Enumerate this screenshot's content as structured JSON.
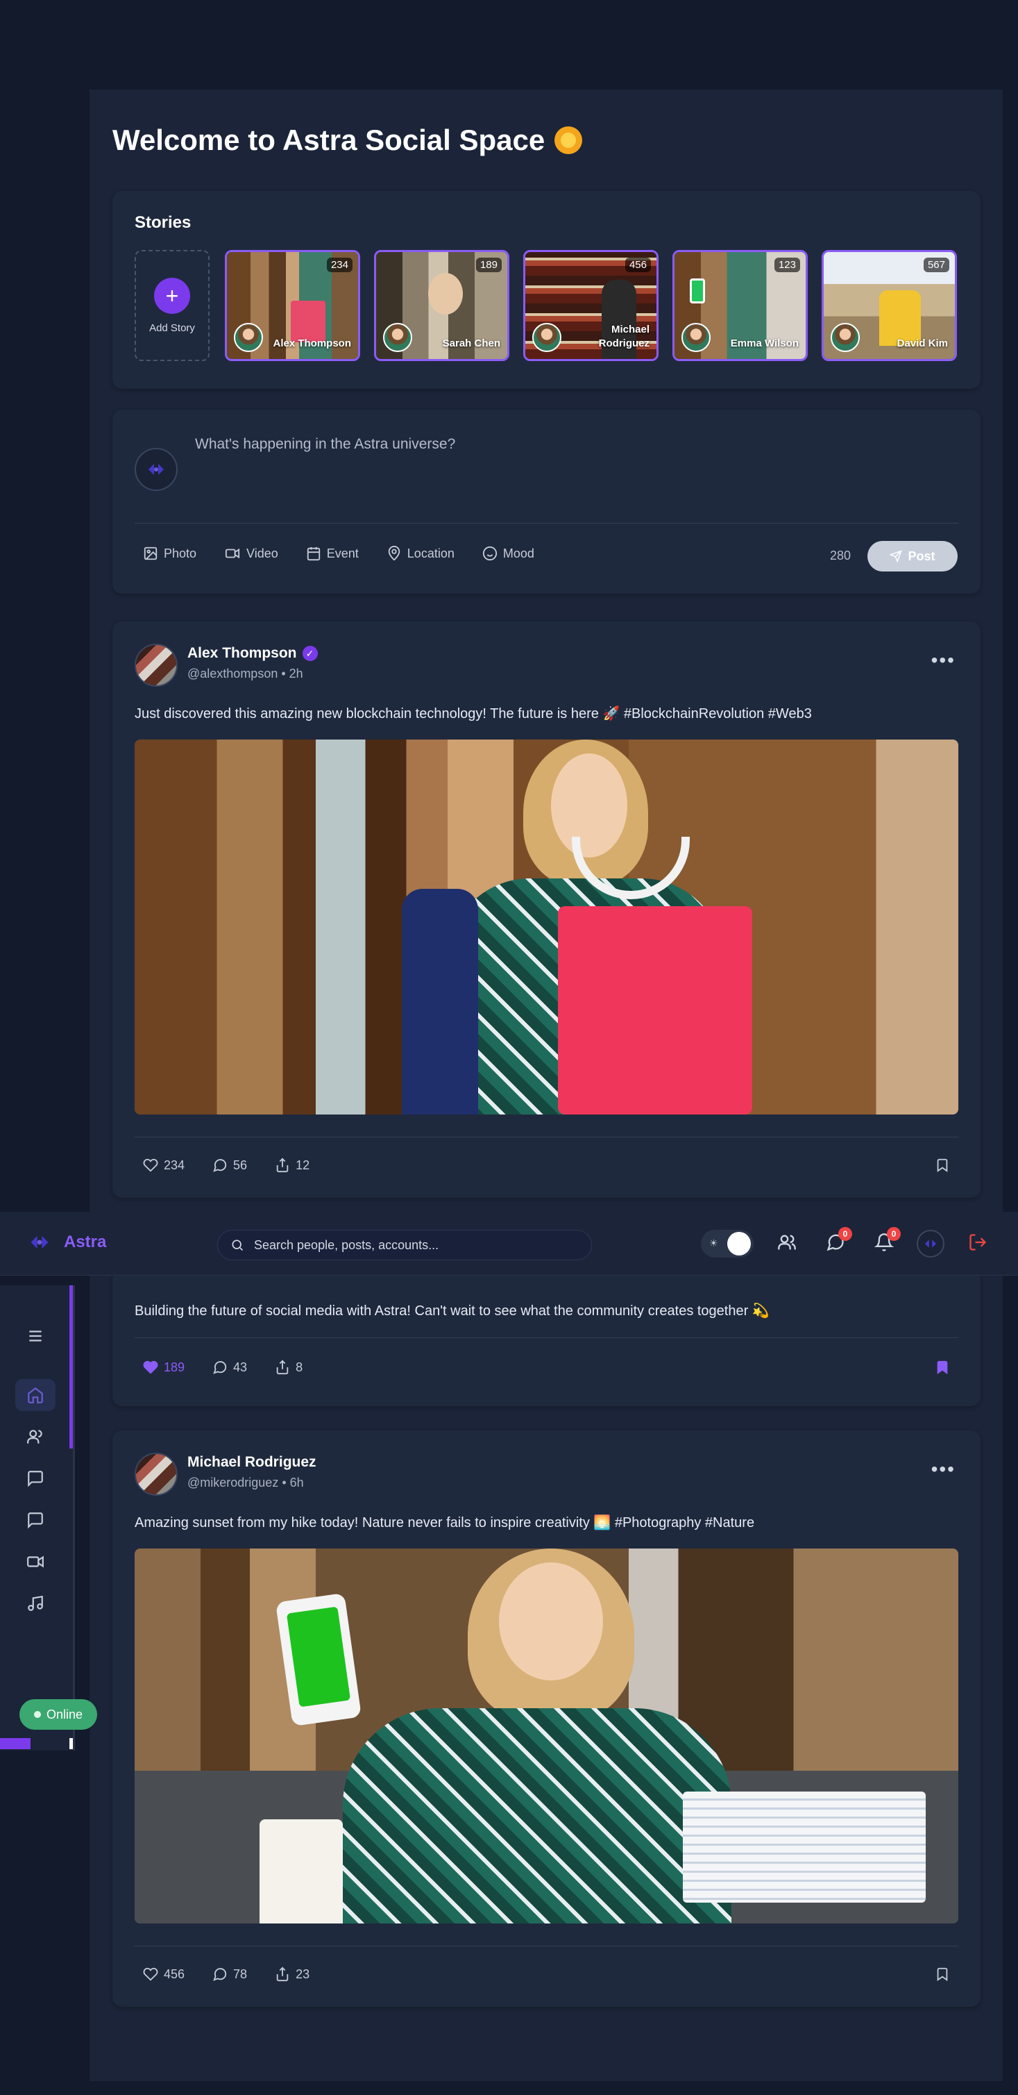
{
  "welcome": {
    "title": "Welcome to Astra Social Space"
  },
  "stories": {
    "title": "Stories",
    "add_label": "Add Story",
    "items": [
      {
        "name": "Alex Thompson",
        "count": "234"
      },
      {
        "name": "Sarah Chen",
        "count": "189"
      },
      {
        "name": "Michael Rodriguez",
        "count": "456"
      },
      {
        "name": "Emma Wilson",
        "count": "123"
      },
      {
        "name": "David Kim",
        "count": "567"
      }
    ]
  },
  "composer": {
    "placeholder": "What's happening in the Astra universe?",
    "actions": [
      "Photo",
      "Video",
      "Event",
      "Location",
      "Mood"
    ],
    "char_count": "280",
    "post_label": "Post"
  },
  "posts": [
    {
      "author": "Alex Thompson",
      "meta": "@alexthompson • 2h",
      "text": "Just discovered this amazing new blockchain technology! The future is here 🚀 #BlockchainRevolution #Web3",
      "likes": "234",
      "comments": "56",
      "shares": "12",
      "verified": true,
      "liked": false,
      "bookmarked": false
    },
    {
      "text": "Building the future of social media with Astra! Can't wait to see what the community creates together 💫",
      "likes": "189",
      "comments": "43",
      "shares": "8",
      "liked": true,
      "bookmarked": true
    },
    {
      "author": "Michael Rodriguez",
      "meta": "@mikerodriguez • 6h",
      "text": "Amazing sunset from my hike today! Nature never fails to inspire creativity 🌅 #Photography #Nature",
      "likes": "456",
      "comments": "78",
      "shares": "23",
      "liked": false,
      "bookmarked": false
    }
  ],
  "header": {
    "brand": "Astra",
    "search_placeholder": "Search people, posts, accounts...",
    "messages_badge": "0",
    "notifications_badge": "0"
  },
  "sidebar": {
    "items": [
      "menu-icon",
      "home-icon",
      "users-icon",
      "chat-icon",
      "message-icon",
      "video-icon",
      "music-icon"
    ],
    "status": "Online"
  },
  "colors": {
    "accent": "#7c3aed",
    "danger": "#ef4444",
    "online": "#3aa870"
  }
}
